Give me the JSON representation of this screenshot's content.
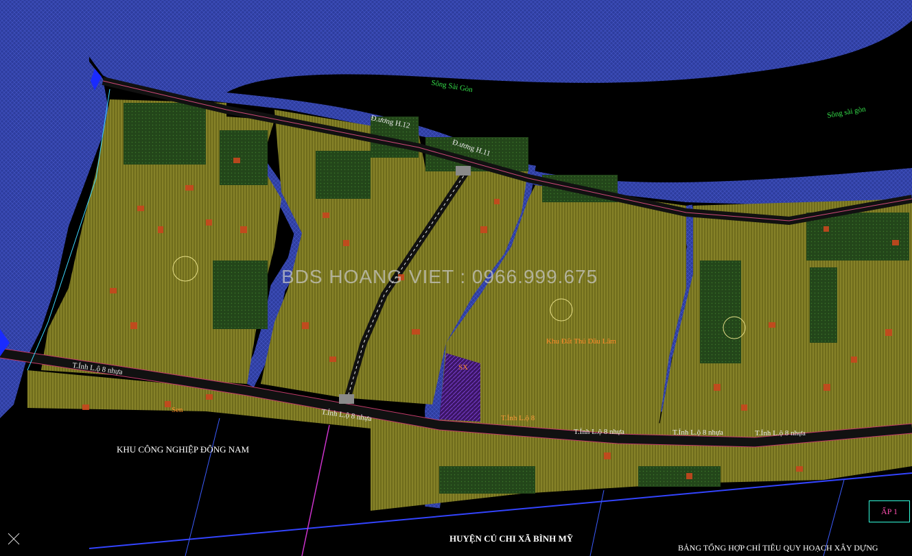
{
  "watermark": "BDS HOANG VIET : 0966.999.675",
  "labels": {
    "river_1": "Sông Sài Gòn",
    "river_2": "Sông sài gòn",
    "road_h11": "Đ.ương H.11",
    "road_h12": "Đ.ương H.12",
    "provincial_1": "T.Ỉnh L.ộ 8 nhựa",
    "provincial_2": "T.Ỉnh L.ộ 8 nhựa",
    "provincial_3": "T.Ỉnh L.ộ 8 nhựa",
    "provincial_4": "T.Ỉnh L.ộ 8 nhựa",
    "provincial_5": "T.Ỉnh L.ộ 8 nhựa",
    "provincial_6": "T.Ỉnh L.ộ 8",
    "industrial_zone": "KHU CÔNG NGHIỆP ĐÔNG NAM",
    "district": "HUYỆN CỦ CHI XÃ BÌNH MỸ",
    "farm": "Sen",
    "park": "Khu Đất Thủ Dầu Lâm",
    "sx_label": "SX"
  },
  "ap_box": "ẤP 1",
  "table_title": "BẢNG TỔNG HỢP CHỈ TIÊU QUY HOẠCH XÂY DỰNG",
  "colors": {
    "water": "#2f3fa8",
    "land_yellow": "#7d7a22",
    "land_green": "#274d1c",
    "road": "#111111",
    "plot_red": "#c8471e",
    "canal_line": "#5b6bff",
    "sx_block": "#4a1f7a"
  }
}
